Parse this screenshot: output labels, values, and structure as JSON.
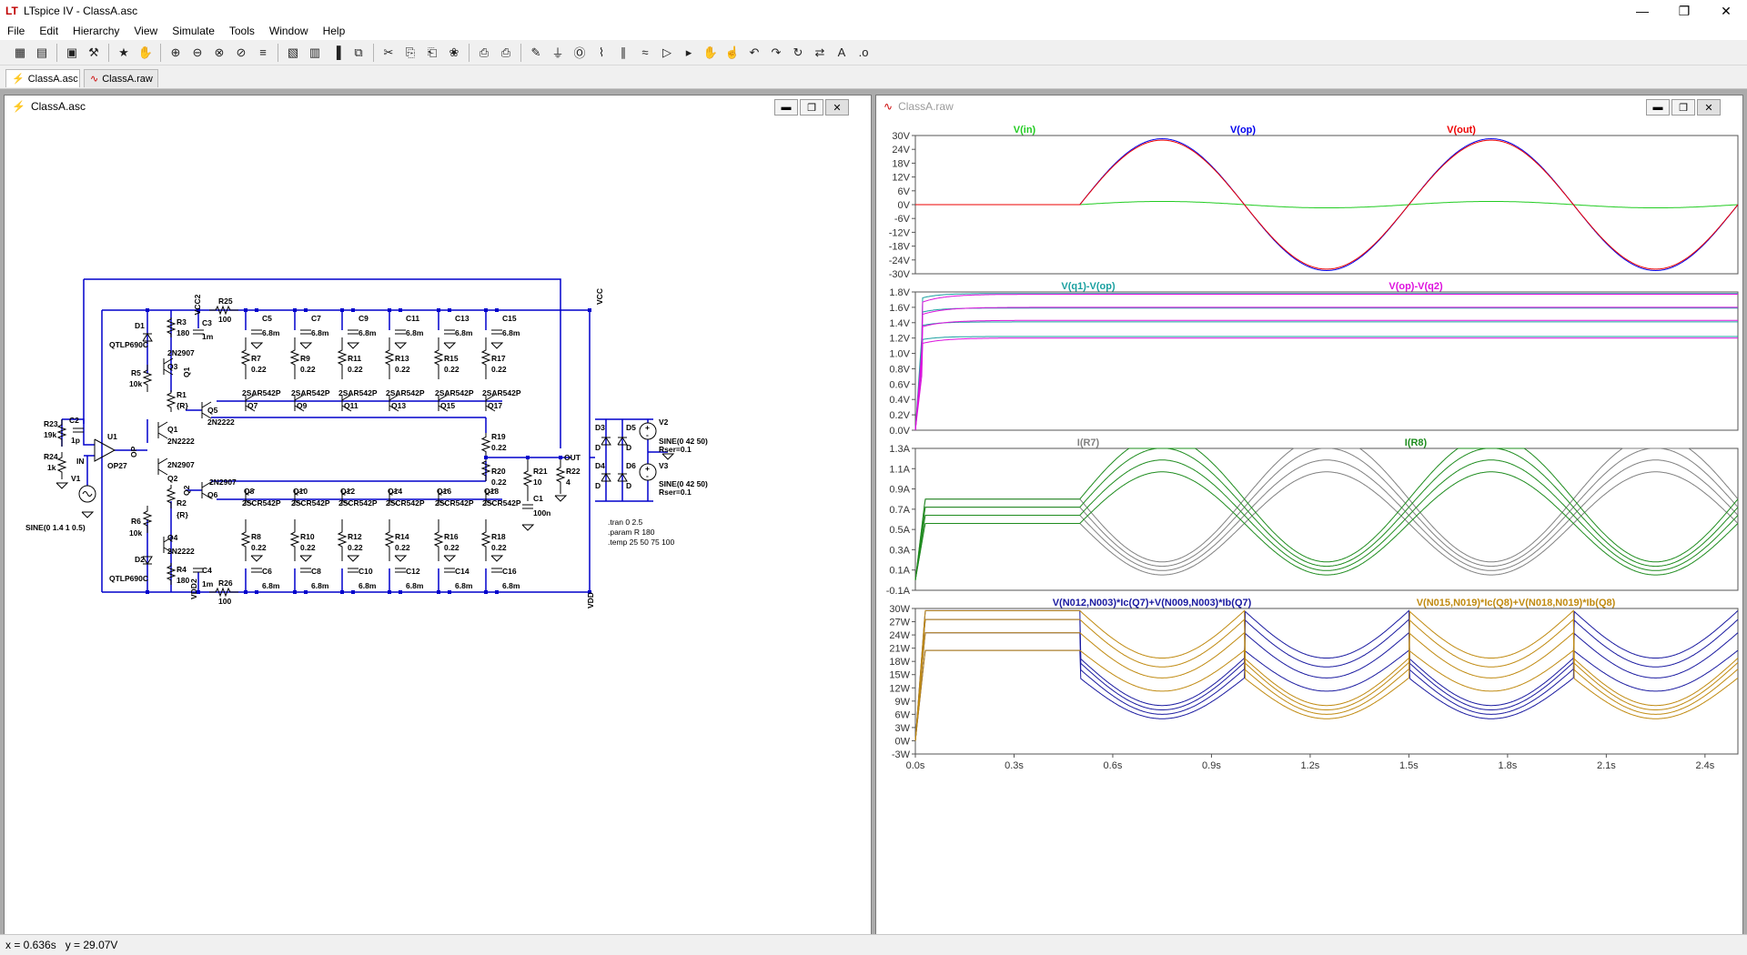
{
  "app": {
    "title": "LTspice IV - ClassA.asc"
  },
  "menu": [
    "File",
    "Edit",
    "Hierarchy",
    "View",
    "Simulate",
    "Tools",
    "Window",
    "Help"
  ],
  "toolbar_icons": [
    "new-schematic-icon",
    "open-icon",
    "save-icon",
    "control-panel-icon",
    "run-icon",
    "halt-icon",
    "zoom-in-icon",
    "zoom-box-icon",
    "zoom-out-icon",
    "zoom-fit-icon",
    "autorange-icon",
    "undock-icon",
    "tile-horizontal-icon",
    "tile-vertical-icon",
    "cascade-icon",
    "cut-icon",
    "copy-icon",
    "paste-icon",
    "find-icon",
    "print-preview-icon",
    "print-icon",
    "draw-wire-icon",
    "ground-icon",
    "label-net-icon",
    "resistor-icon",
    "capacitor-icon",
    "inductor-icon",
    "diode-icon",
    "component-icon",
    "move-icon",
    "drag-icon",
    "undo-icon",
    "redo-icon",
    "rotate-icon",
    "mirror-icon",
    "text-icon",
    "spice-directive-icon"
  ],
  "tabs": [
    {
      "label": "ClassA.asc",
      "active": true
    },
    {
      "label": "ClassA.raw",
      "active": false
    }
  ],
  "schematic": {
    "window_title": "ClassA.asc",
    "labels": {
      "vcc2": "VCC2",
      "vcc": "VCC",
      "vdd2": "VDD2",
      "vdd": "VDD",
      "out": "OUT",
      "in": "IN",
      "op": "OP",
      "q1net": "Q1",
      "q2net": "Q2",
      "r25": "R25",
      "r25v": "100",
      "r26": "R26",
      "r26v": "100",
      "d1": "D1",
      "d1m": "QTLP690C",
      "d2": "D2",
      "d2m": "QTLP690C",
      "r3": "R3",
      "r3v": "180",
      "r4": "R4",
      "r4v": "180",
      "r5": "R5",
      "r5v": "10k",
      "r6": "R6",
      "r6v": "10k",
      "q3": "Q3",
      "q3m": "2N2907",
      "q4": "Q4",
      "q4m": "2N2222",
      "r1": "R1",
      "r1v": "{R}",
      "r2": "R2",
      "r2v": "{R}",
      "q1": "Q1",
      "q1m": "2N2222",
      "q2": "Q2",
      "q2m": "2N2907",
      "q5": "Q5",
      "q5m": "2N2222",
      "q6": "Q6",
      "q6m": "2N2907",
      "c3": "C3",
      "c3v": "1m",
      "c4": "C4",
      "c4v": "1m",
      "u1": "U1",
      "u1m": "OP27",
      "r23": "R23",
      "r23v": "19k",
      "r24": "R24",
      "r24v": "1k",
      "c2": "C2",
      "c2v": "1p",
      "v1": "V1",
      "v1src": "SINE(0 1.4 1 0.5)",
      "r19": "R19",
      "r19v": "0.22",
      "r20": "R20",
      "r20v": "0.22",
      "r21": "R21",
      "r21v": "10",
      "r22": "R22",
      "r22v": "4",
      "c1": "C1",
      "c1v": "100n",
      "v2": "V2",
      "v2src": "SINE(0 42 50)",
      "v2r": "Rser=0.1",
      "v3": "V3",
      "v3src": "SINE(0 42 50)",
      "v3r": "Rser=0.1",
      "d3": "D3",
      "d4": "D4",
      "d5": "D5",
      "d6": "D6",
      "dm": "D",
      "npn": "2SAR542P",
      "pnp": "2SCR542P",
      "rv": "0.22",
      "cv": "6.8m"
    },
    "upper_stages": [
      {
        "c": "C5",
        "r": "R7",
        "q": "Q7"
      },
      {
        "c": "C7",
        "r": "R9",
        "q": "Q9"
      },
      {
        "c": "C9",
        "r": "R11",
        "q": "Q11"
      },
      {
        "c": "C11",
        "r": "R13",
        "q": "Q13"
      },
      {
        "c": "C13",
        "r": "R15",
        "q": "Q15"
      },
      {
        "c": "C15",
        "r": "R17",
        "q": "Q17"
      }
    ],
    "lower_stages": [
      {
        "c": "C6",
        "r": "R8",
        "q": "Q8"
      },
      {
        "c": "C8",
        "r": "R10",
        "q": "Q10"
      },
      {
        "c": "C10",
        "r": "R12",
        "q": "Q12"
      },
      {
        "c": "C12",
        "r": "R14",
        "q": "Q14"
      },
      {
        "c": "C14",
        "r": "R16",
        "q": "Q16"
      },
      {
        "c": "C16",
        "r": "R18",
        "q": "Q18"
      }
    ],
    "directives": [
      ".tran 0 2.5",
      ".param R 180",
      ".temp 25 50 75 100"
    ]
  },
  "waveform": {
    "window_title": "ClassA.raw",
    "x_ticks": [
      "0.0s",
      "0.3s",
      "0.6s",
      "0.9s",
      "1.2s",
      "1.5s",
      "1.8s",
      "2.1s",
      "2.4s"
    ],
    "panes": [
      {
        "traces": [
          {
            "label": "V(in)",
            "color": "#22cc22"
          },
          {
            "label": "V(op)",
            "color": "#0000ee"
          },
          {
            "label": "V(out)",
            "color": "#ee0000"
          }
        ],
        "y_ticks": [
          "30V",
          "24V",
          "18V",
          "12V",
          "6V",
          "0V",
          "-6V",
          "-12V",
          "-18V",
          "-24V",
          "-30V"
        ]
      },
      {
        "traces": [
          {
            "label": "V(q1)-V(op)",
            "color": "#1aa0a0"
          },
          {
            "label": "V(op)-V(q2)",
            "color": "#dd11dd"
          }
        ],
        "y_ticks": [
          "1.8V",
          "1.6V",
          "1.4V",
          "1.2V",
          "1.0V",
          "0.8V",
          "0.6V",
          "0.4V",
          "0.2V",
          "0.0V"
        ]
      },
      {
        "traces": [
          {
            "label": "I(R7)",
            "color": "#808080"
          },
          {
            "label": "I(R8)",
            "color": "#1e8c1e"
          }
        ],
        "y_ticks": [
          "1.3A",
          "1.1A",
          "0.9A",
          "0.7A",
          "0.5A",
          "0.3A",
          "0.1A",
          "-0.1A"
        ]
      },
      {
        "traces": [
          {
            "label": "V(N012,N003)*Ic(Q7)+V(N009,N003)*Ib(Q7)",
            "color": "#1a1aa0"
          },
          {
            "label": "V(N015,N019)*Ic(Q8)+V(N018,N019)*Ib(Q8)",
            "color": "#c08a10"
          }
        ],
        "y_ticks": [
          "30W",
          "27W",
          "24W",
          "21W",
          "18W",
          "15W",
          "12W",
          "9W",
          "6W",
          "3W",
          "0W",
          "-3W"
        ]
      }
    ]
  },
  "status": {
    "text": "x = 0.636s   y = 29.07V"
  }
}
